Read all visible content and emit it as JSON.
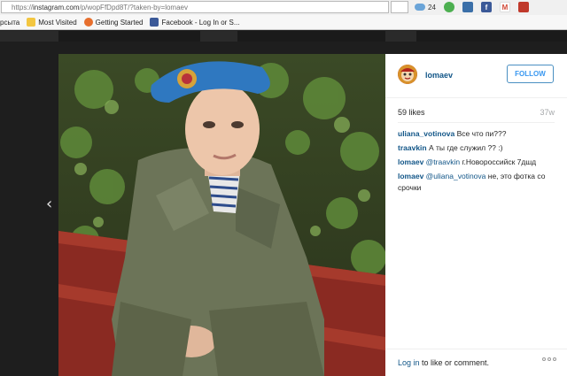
{
  "browser": {
    "url_scheme": "https://",
    "url_host": "instagram.com",
    "url_path": "/p/wopFfDpd8T/?taken-by=lomaev",
    "weather_temp": "24",
    "bookmarks": [
      {
        "label": "рсыта",
        "icon": "folder-icon"
      },
      {
        "label": "Most Visited",
        "icon": "star-icon"
      },
      {
        "label": "Getting Started",
        "icon": "firefox-icon"
      },
      {
        "label": "Facebook - Log In or S...",
        "icon": "facebook-icon"
      }
    ],
    "toolbar_icons": [
      "weather-icon",
      "green-addon-icon",
      "chrome-addon-icon",
      "facebook-icon",
      "gmail-icon",
      "red-addon-icon"
    ]
  },
  "post": {
    "username": "lomaev",
    "follow_label": "FOLLOW",
    "likes": "59 likes",
    "age": "37w",
    "comments": [
      {
        "user": "uliana_votinova",
        "mention": "",
        "text": "Все что пи???"
      },
      {
        "user": "traavkin",
        "mention": "",
        "text": "А ты где служил ?? :)"
      },
      {
        "user": "lomaev",
        "mention": "@traavkin",
        "text": "г.Новороссийск 7дшд"
      },
      {
        "user": "lomaev",
        "mention": "@uliana_votinova",
        "text": "не, это фотка со срочки"
      }
    ],
    "footer_link": "Log in",
    "footer_text": " to like or comment."
  },
  "colors": {
    "link": "#125688",
    "follow": "#3897f0",
    "backdrop": "#1e1e1e"
  }
}
